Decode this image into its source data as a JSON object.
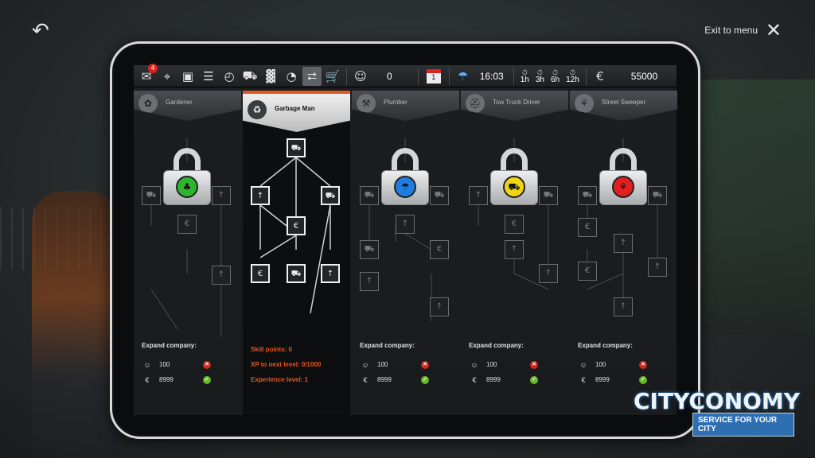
{
  "header": {
    "exit_label": "Exit to menu"
  },
  "toolbar": {
    "mail_badge": "4",
    "reputation": "0",
    "calendar_day": "1",
    "time": "16:03",
    "speeds": [
      "1h",
      "3h",
      "6h",
      "12h"
    ],
    "money": "55000"
  },
  "columns": [
    {
      "title": "Gardener",
      "locked": true,
      "dot_color": "#2db52f",
      "expand_label": "Expand company:",
      "cost_reputation": "100",
      "cost_money": "8999"
    },
    {
      "title": "Garbage Man",
      "locked": false,
      "skill_points": "Skill points: 0",
      "xp_next": "XP to next level: 0/1000",
      "experience": "Experience level: 1"
    },
    {
      "title": "Plumber",
      "locked": true,
      "dot_color": "#1e7de0",
      "expand_label": "Expand company:",
      "cost_reputation": "100",
      "cost_money": "8999"
    },
    {
      "title": "Tow Truck Driver",
      "locked": true,
      "dot_color": "#f0d41a",
      "expand_label": "Expand company:",
      "cost_reputation": "100",
      "cost_money": "8999"
    },
    {
      "title": "Street Sweeper",
      "locked": true,
      "dot_color": "#e0201e",
      "expand_label": "Expand company:",
      "cost_reputation": "100",
      "cost_money": "8999"
    }
  ],
  "logo": {
    "main": "CITYCONOMY",
    "sub": "SERVICE FOR YOUR CITY"
  }
}
